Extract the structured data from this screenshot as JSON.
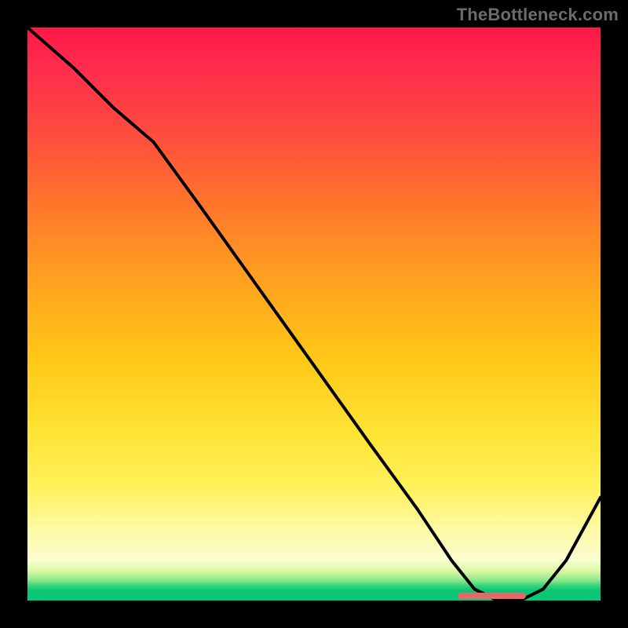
{
  "watermark": "TheBottleneck.com",
  "chart_data": {
    "type": "line",
    "title": "",
    "xlabel": "",
    "ylabel": "",
    "xlim": [
      0,
      100
    ],
    "ylim": [
      0,
      100
    ],
    "grid": false,
    "legend": false,
    "series": [
      {
        "name": "bottleneck-curve",
        "x": [
          0,
          8,
          15,
          22,
          30,
          40,
          50,
          60,
          68,
          74,
          78,
          82,
          86,
          90,
          94,
          100
        ],
        "values": [
          100,
          93,
          86,
          80,
          69,
          55,
          41,
          27,
          16,
          7,
          2,
          0,
          0,
          2,
          7,
          18
        ]
      }
    ],
    "optimal_marker": {
      "x_start": 75,
      "x_end": 87,
      "y": 0,
      "color": "#e46a6a"
    },
    "gradient_stops": [
      {
        "pos": 0,
        "color": "#ff1744"
      },
      {
        "pos": 0.45,
        "color": "#ffa41f"
      },
      {
        "pos": 0.8,
        "color": "#fff159"
      },
      {
        "pos": 0.95,
        "color": "#d6f7a0"
      },
      {
        "pos": 1.0,
        "color": "#0ac775"
      }
    ]
  }
}
